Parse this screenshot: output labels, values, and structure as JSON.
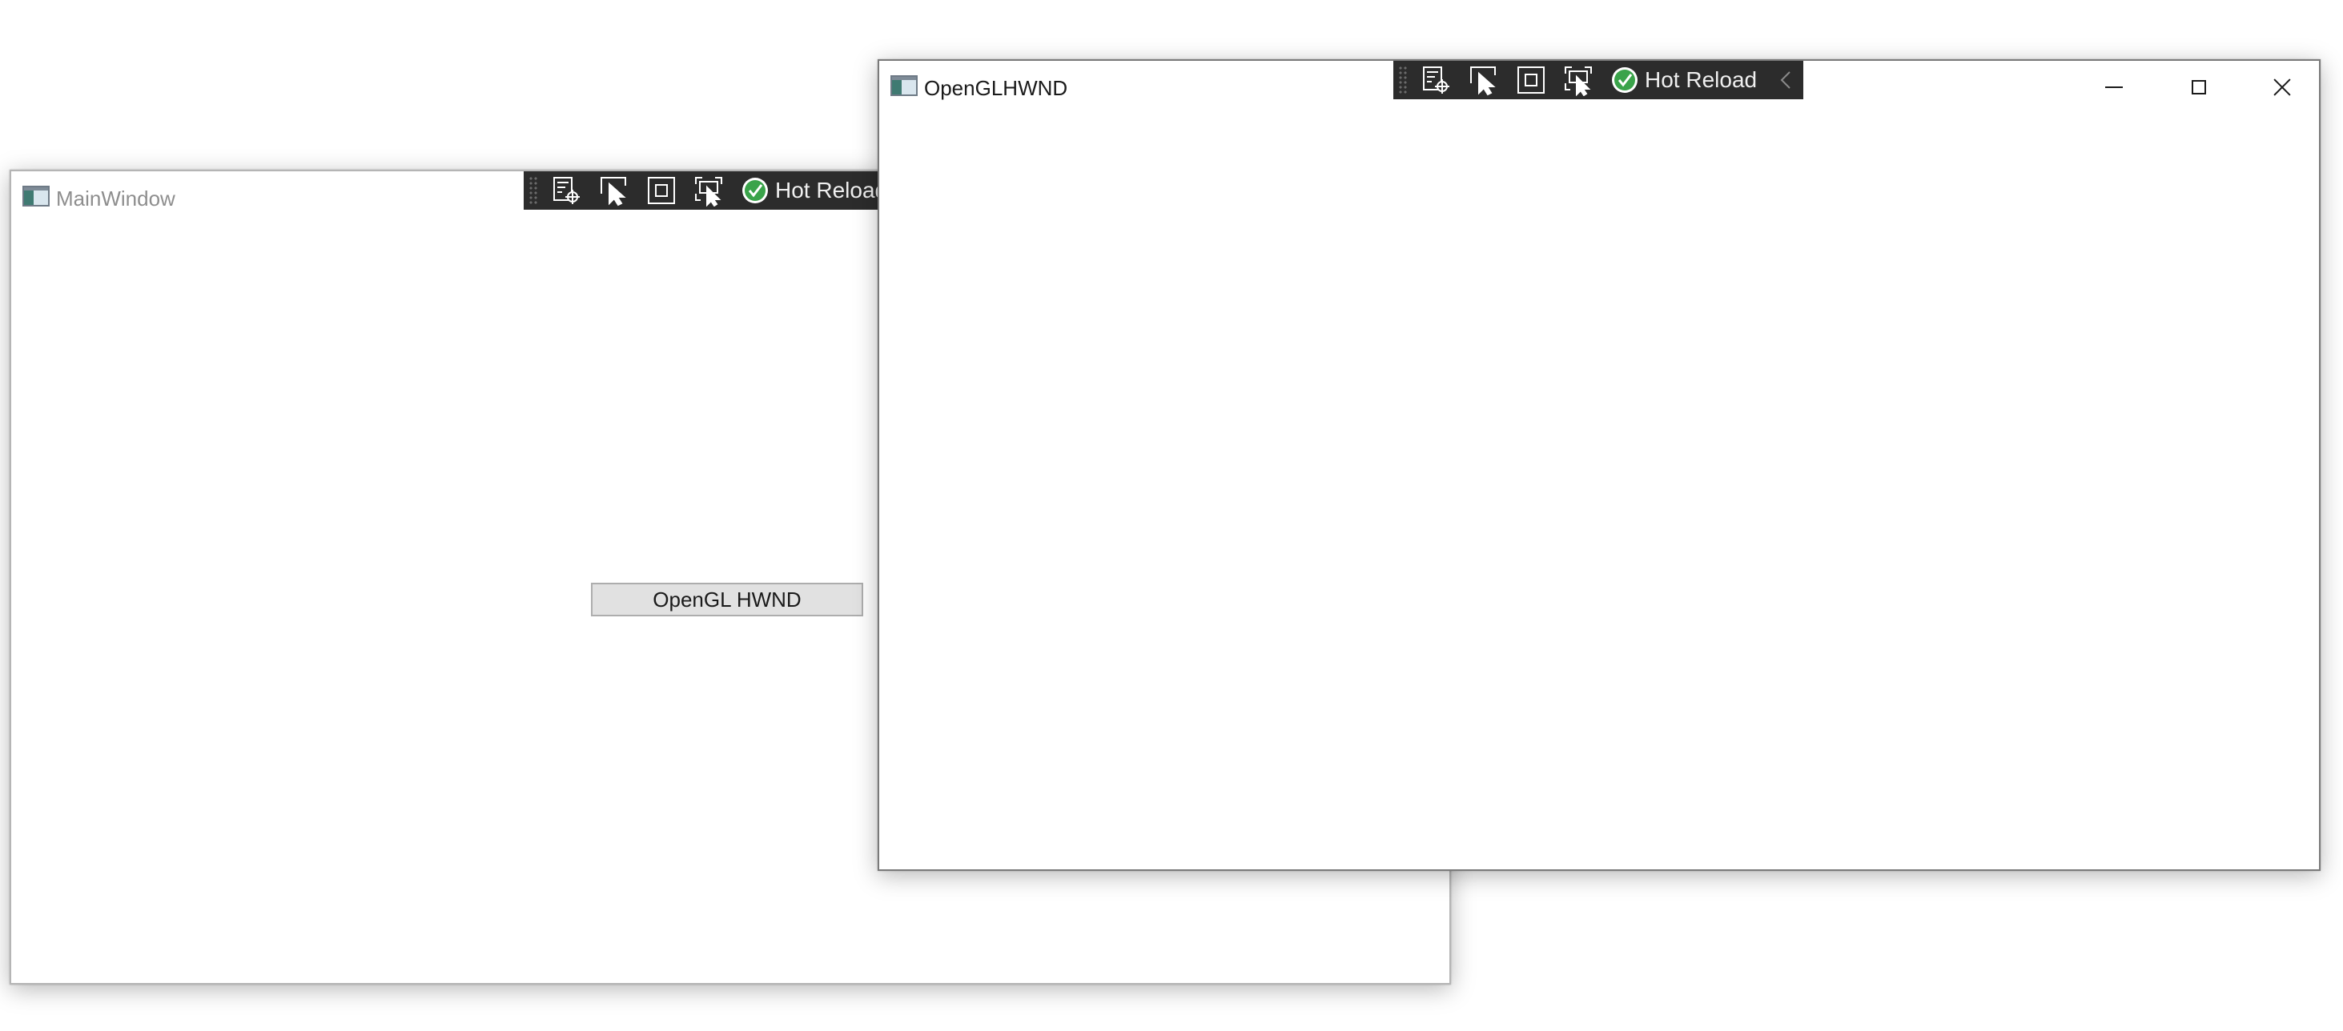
{
  "windows": {
    "main": {
      "title": "MainWindow",
      "button_label": "OpenGL HWND",
      "devbar": {
        "hot_reload_label": "Hot Reload"
      }
    },
    "gl": {
      "title": "OpenGLHWND",
      "devbar": {
        "hot_reload_label": "Hot Reload"
      }
    }
  },
  "icons": {
    "toolbar": [
      "live-visual-tree-icon",
      "select-element-icon",
      "display-layout-adorners-icon",
      "track-focus-icon",
      "hot-reload-status-icon",
      "collapse-toolbar-chevron-icon"
    ],
    "caption": [
      "minimize-icon",
      "maximize-icon",
      "close-icon"
    ],
    "app": "app-window-icon"
  },
  "colors": {
    "devbar_background": "#2c2c2c",
    "hot_reload_ok": "#3aa34a",
    "button_face": "#e1e1e1",
    "inactive_title": "#8e8e8e"
  }
}
